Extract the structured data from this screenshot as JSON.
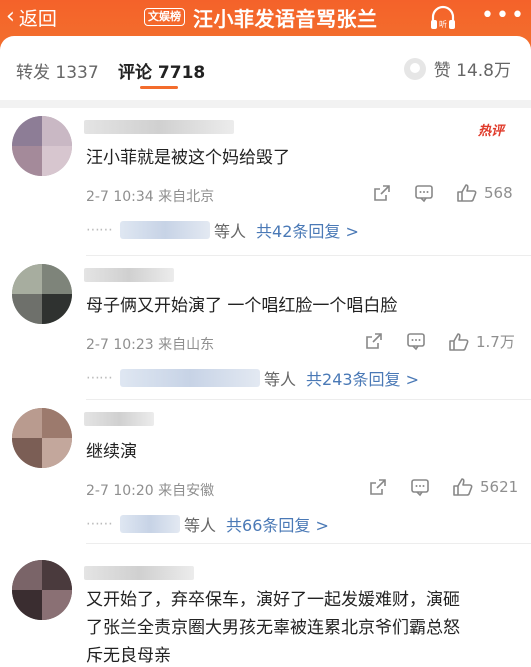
{
  "topbar": {
    "back_label": "返回",
    "badge": "文娱榜",
    "title": "汪小菲发语音骂张兰",
    "listen_label": "听",
    "more_label": "•••"
  },
  "tabs": {
    "repost_label": "转发 1337",
    "comment_label": "评论 7718",
    "like_label": "赞 14.8万"
  },
  "comments": [
    {
      "hot": "热评",
      "text": "汪小菲就是被这个妈给毁了",
      "meta": "2-7 10:34 来自北京",
      "likes": "568",
      "reply_suffix": "等人",
      "reply_link": "共42条回复 >"
    },
    {
      "text": "母子俩又开始演了 一个唱红脸一个唱白脸",
      "meta": "2-7 10:23 来自山东",
      "likes": "1.7万",
      "reply_suffix": "等人",
      "reply_link": "共243条回复 >"
    },
    {
      "text": "继续演",
      "meta": "2-7 10:20 来自安徽",
      "likes": "5621",
      "reply_suffix": "等人",
      "reply_link": "共66条回复 >"
    },
    {
      "text_lines": [
        "又开始了，弃卒保车，演好了一起发媛难财，演砸",
        "了张兰全责京圈大男孩无辜被连累北京爷们霸总怒",
        "斥无良母亲"
      ]
    }
  ],
  "colors": {
    "accent": "#f36c2c",
    "link": "#4a79b6",
    "hot": "#e03b2b"
  }
}
